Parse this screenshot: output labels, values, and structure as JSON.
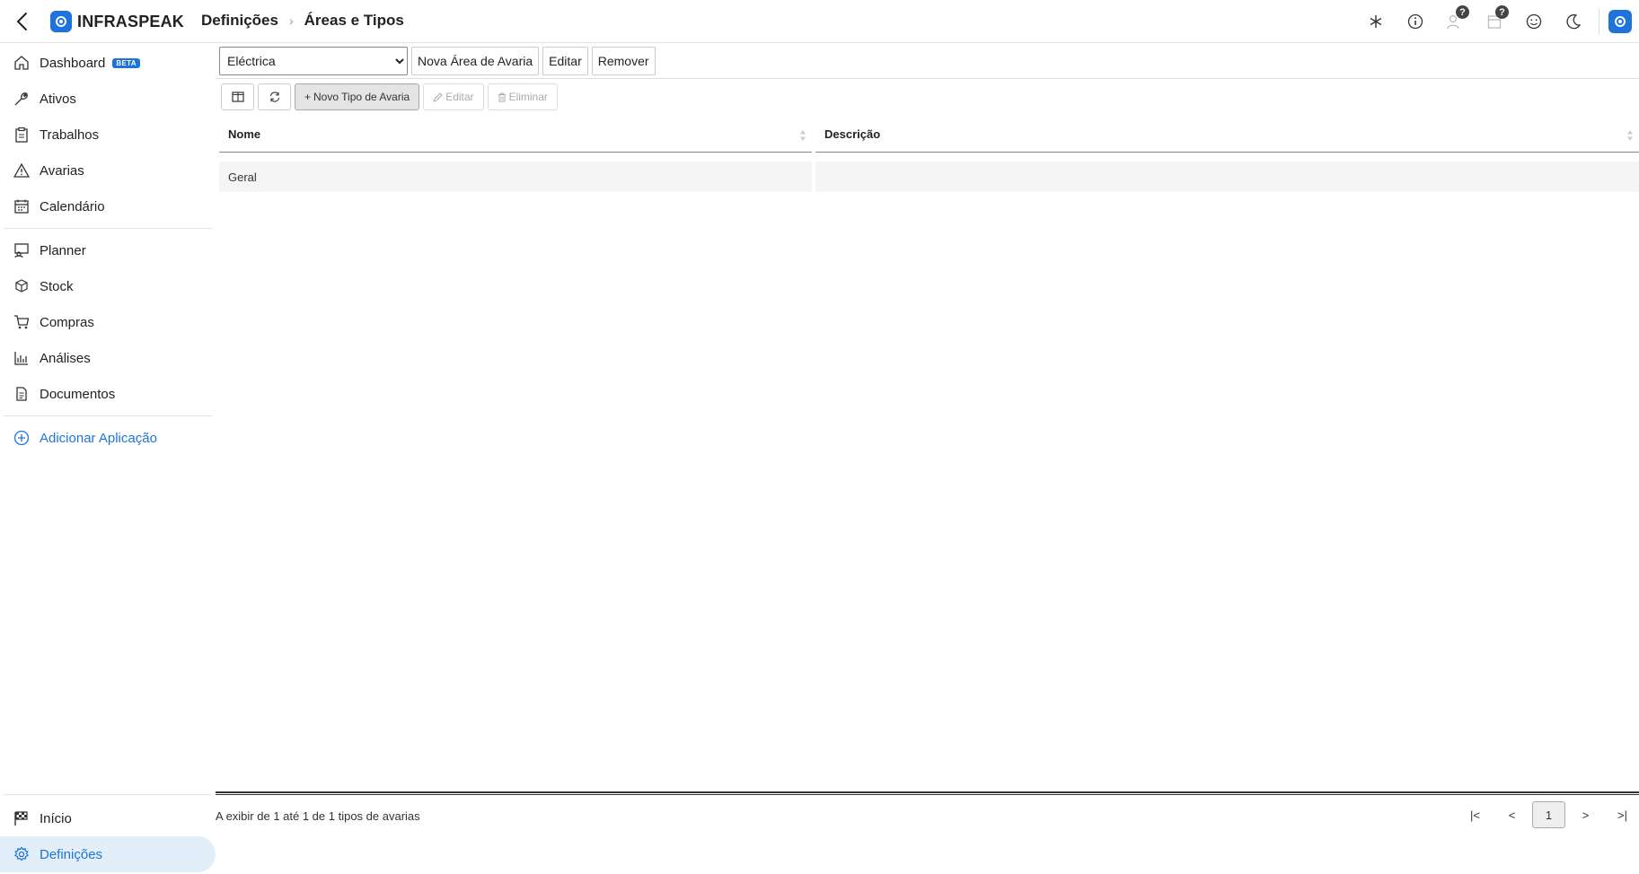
{
  "header": {
    "brand": "INFRASPEAK",
    "breadcrumb": [
      "Definições",
      "Áreas e Tipos"
    ],
    "badge_1": "?",
    "badge_2": "?"
  },
  "sidebar": {
    "items": [
      {
        "label": "Dashboard",
        "icon": "home-icon",
        "badge": "BETA"
      },
      {
        "label": "Ativos",
        "icon": "wrench-icon"
      },
      {
        "label": "Trabalhos",
        "icon": "clipboard-icon"
      },
      {
        "label": "Avarias",
        "icon": "warning-icon"
      },
      {
        "label": "Calendário",
        "icon": "calendar-icon"
      },
      {
        "label": "Planner",
        "icon": "planner-icon"
      },
      {
        "label": "Stock",
        "icon": "boxes-icon"
      },
      {
        "label": "Compras",
        "icon": "cart-icon"
      },
      {
        "label": "Análises",
        "icon": "bar-chart-icon"
      },
      {
        "label": "Documentos",
        "icon": "document-icon"
      }
    ],
    "add_app": "Adicionar Aplicação",
    "bottom": [
      {
        "label": "Início",
        "icon": "flag-icon"
      },
      {
        "label": "Definições",
        "icon": "gear-icon",
        "active": true
      }
    ]
  },
  "toolbar": {
    "area_selected": "Eléctrica",
    "new_area": "Nova Área de Avaria",
    "edit": "Editar",
    "remove": "Remover"
  },
  "grid_toolbar": {
    "new_type": "Novo Tipo de Avaria",
    "edit": "Editar",
    "delete": "Eliminar"
  },
  "table": {
    "columns": [
      "Nome",
      "Descrição"
    ],
    "rows": [
      {
        "nome": "Geral",
        "descricao": ""
      }
    ]
  },
  "footer": {
    "info": "A exibir de 1 até 1 de 1 tipos de avarias",
    "pager": {
      "first": "|<",
      "prev": "<",
      "page": "1",
      "next": ">",
      "last": ">|"
    }
  },
  "colors": {
    "accent": "#1f74d9",
    "active_bg": "#e2eefa"
  }
}
